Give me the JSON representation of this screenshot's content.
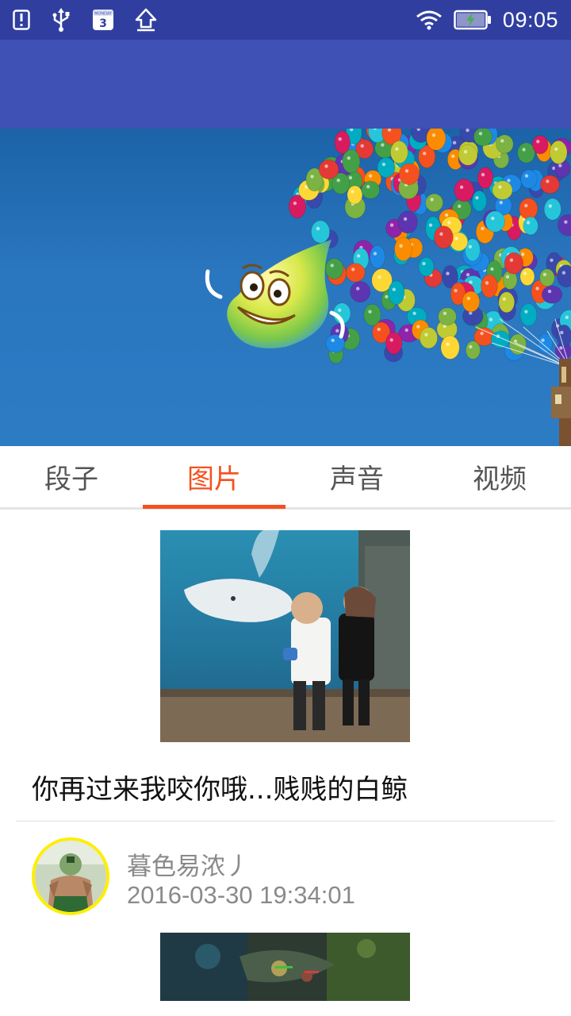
{
  "status_bar": {
    "time": "09:05",
    "calendar_day": "3",
    "calendar_weekday": "MONDAY",
    "icons": [
      "alert-icon",
      "usb-icon",
      "calendar-icon",
      "upload-icon",
      "wifi-icon",
      "battery-charging-icon"
    ]
  },
  "app_bar": {
    "color": "#3f51b5"
  },
  "status_bar_color": "#303f9f",
  "tabs": [
    {
      "label": "段子",
      "active": false
    },
    {
      "label": "图片",
      "active": true
    },
    {
      "label": "声音",
      "active": false
    },
    {
      "label": "视频",
      "active": false
    }
  ],
  "accent_color": "#f4511e",
  "posts": [
    {
      "title": "你再过来我咬你哦...贱贱的白鲸",
      "author": "暮色易浓丿",
      "timestamp": "2016-03-30 19:34:01"
    }
  ]
}
